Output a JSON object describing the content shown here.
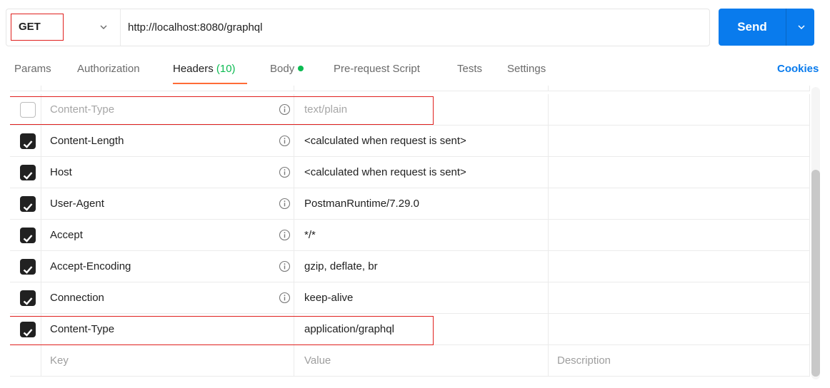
{
  "request": {
    "method": "GET",
    "url": "http://localhost:8080/graphql",
    "send_label": "Send"
  },
  "tabs": [
    {
      "label": "Params"
    },
    {
      "label": "Authorization"
    },
    {
      "label": "Headers",
      "count": "(10)",
      "active": true
    },
    {
      "label": "Body",
      "indicator": "green-dot"
    },
    {
      "label": "Pre-request Script"
    },
    {
      "label": "Tests"
    },
    {
      "label": "Settings"
    }
  ],
  "cookies_label": "Cookies",
  "headers": {
    "rows": [
      {
        "checked": false,
        "key": "Content-Type",
        "value": "text/plain",
        "disabled": true
      },
      {
        "checked": true,
        "key": "Content-Length",
        "value": "<calculated when request is sent>"
      },
      {
        "checked": true,
        "key": "Host",
        "value": "<calculated when request is sent>"
      },
      {
        "checked": true,
        "key": "User-Agent",
        "value": "PostmanRuntime/7.29.0"
      },
      {
        "checked": true,
        "key": "Accept",
        "value": "*/*"
      },
      {
        "checked": true,
        "key": "Accept-Encoding",
        "value": "gzip, deflate, br"
      },
      {
        "checked": true,
        "key": "Connection",
        "value": "keep-alive"
      },
      {
        "checked": true,
        "key": "Content-Type",
        "value": "application/graphql"
      }
    ],
    "placeholder": {
      "key": "Key",
      "value": "Value",
      "description": "Description"
    }
  },
  "colors": {
    "accent": "#097bed",
    "tab_underline": "#ff6c37",
    "count_green": "#0cbb52",
    "highlight_red": "#e0201e"
  },
  "icons": [
    "chevron-down-icon",
    "info-icon",
    "checkbox-checked-icon",
    "checkbox-unchecked-icon"
  ]
}
